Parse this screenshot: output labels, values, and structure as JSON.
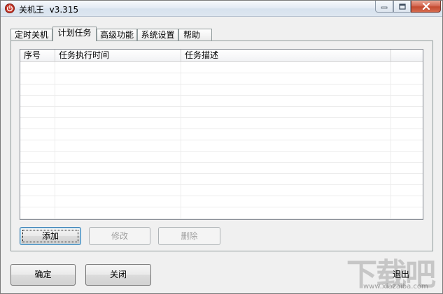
{
  "window": {
    "title": "关机王  v3.315",
    "accent_close": "#c44a30"
  },
  "tabs": [
    {
      "label": "定时关机",
      "active": false
    },
    {
      "label": "计划任务",
      "active": true
    },
    {
      "label": "高级功能",
      "active": false
    },
    {
      "label": "系统设置",
      "active": false
    },
    {
      "label": "帮助",
      "active": false
    }
  ],
  "task_list": {
    "columns": [
      "序号",
      "任务执行时间",
      "任务描述",
      ""
    ],
    "rows": []
  },
  "task_buttons": {
    "add": "添加",
    "edit": "修改",
    "delete": "删除"
  },
  "footer": {
    "ok": "确定",
    "close": "关闭",
    "exit": "退出"
  },
  "watermark": {
    "logo_text": "下载吧",
    "site": "www.xiazaiba.com"
  }
}
